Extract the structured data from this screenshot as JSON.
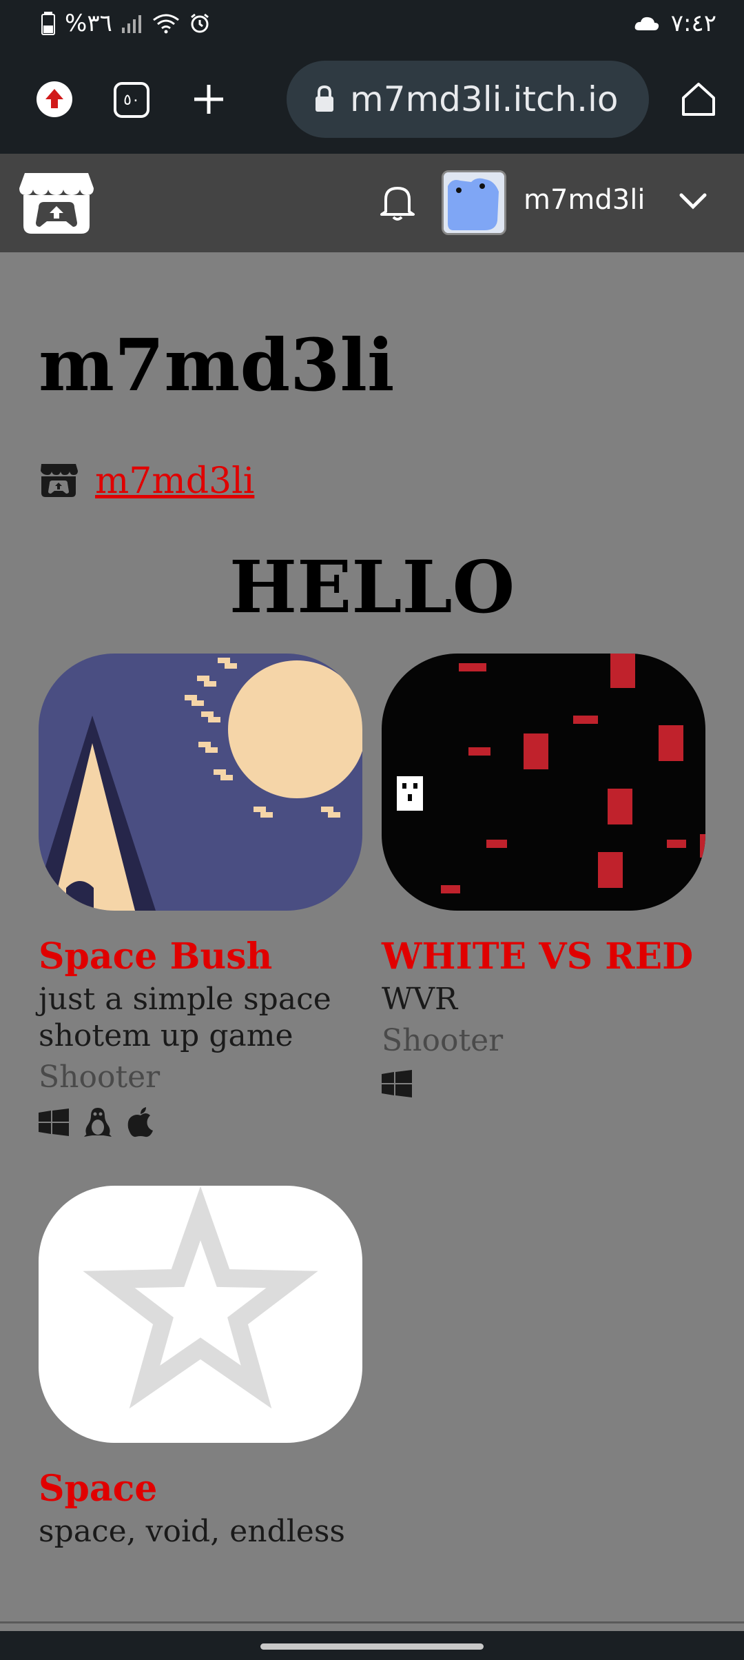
{
  "status_bar": {
    "battery_text": "%٣٦",
    "time": "٧:٤٢"
  },
  "browser": {
    "url": "m7md3li.itch.io",
    "tab_count": "٥٠"
  },
  "itch_header": {
    "username": "m7md3li"
  },
  "profile": {
    "title": "m7md3li",
    "link_text": "m7md3li",
    "heading": "HELLO"
  },
  "games": [
    {
      "title": "Space Bush",
      "description": "just a simple space shotem up game",
      "genre": "Shooter",
      "platforms": [
        "windows-icon",
        "linux-icon",
        "apple-icon"
      ]
    },
    {
      "title": "WHITE VS RED",
      "description": "WVR",
      "genre": "Shooter",
      "platforms": [
        "windows-icon"
      ]
    },
    {
      "title": "Space",
      "description": "space, void, endless"
    }
  ],
  "colors": {
    "page_bg": "#808080",
    "header_bg": "#444444",
    "link_red": "#e00000",
    "browser_bg": "#1a1f23"
  }
}
